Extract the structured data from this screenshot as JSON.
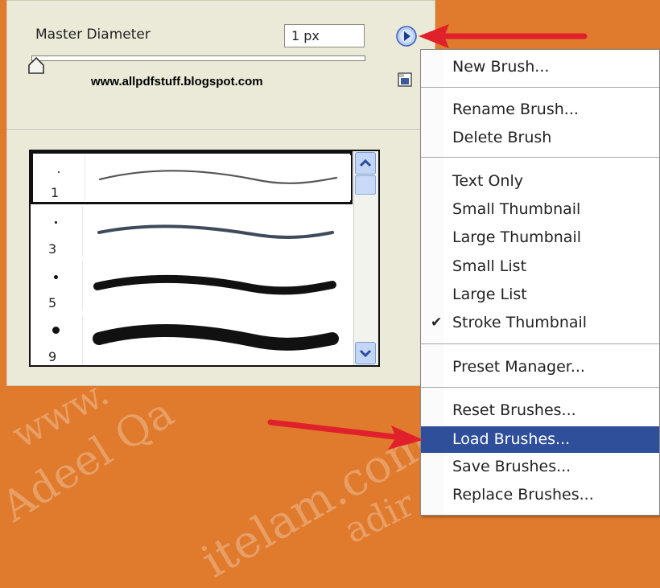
{
  "background": {
    "color": "#e07a2c",
    "watermark_lines": [
      "www.",
      "Adeel Qa",
      "itelam.com",
      "adir"
    ]
  },
  "panel": {
    "master_diameter_label": "Master Diameter",
    "diameter_value": "1 px",
    "website": "www.allpdfstuff.blogspot.com",
    "menu_button_icon": "circle-arrow-right-icon",
    "new_preset_icon": "new-preset-icon",
    "brushes": [
      {
        "size": "1",
        "selected": true
      },
      {
        "size": "3",
        "selected": false
      },
      {
        "size": "5",
        "selected": false
      },
      {
        "size": "9",
        "selected": false
      }
    ]
  },
  "menu": {
    "items": [
      {
        "label": "New Brush...",
        "checked": false,
        "highlight": false
      },
      {
        "label": "Rename Brush...",
        "checked": false,
        "highlight": false
      },
      {
        "label": "Delete Brush",
        "checked": false,
        "highlight": false
      },
      {
        "label": "Text Only",
        "checked": false,
        "highlight": false
      },
      {
        "label": "Small Thumbnail",
        "checked": false,
        "highlight": false
      },
      {
        "label": "Large Thumbnail",
        "checked": false,
        "highlight": false
      },
      {
        "label": "Small List",
        "checked": false,
        "highlight": false
      },
      {
        "label": "Large List",
        "checked": false,
        "highlight": false
      },
      {
        "label": "Stroke Thumbnail",
        "checked": true,
        "highlight": false
      },
      {
        "label": "Preset Manager...",
        "checked": false,
        "highlight": false
      },
      {
        "label": "Reset Brushes...",
        "checked": false,
        "highlight": false
      },
      {
        "label": "Load Brushes...",
        "checked": false,
        "highlight": true
      },
      {
        "label": "Save Brushes...",
        "checked": false,
        "highlight": false
      },
      {
        "label": "Replace Brushes...",
        "checked": false,
        "highlight": false
      }
    ],
    "highlight_color": "#2f4f9a"
  },
  "annotations": {
    "arrow_color": "#e0202a"
  }
}
